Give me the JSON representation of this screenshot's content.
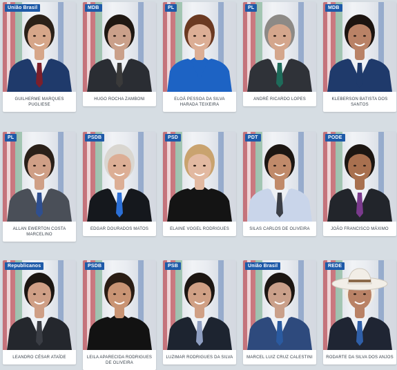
{
  "colors": {
    "badge": "#1e5aa8",
    "background": "#d6dde3",
    "card": "#ffffff",
    "name_text": "#333c46"
  },
  "members": [
    {
      "party": "União Brasil",
      "name": "Guilherme Marques Pugliese",
      "suit": "#1f3a6b",
      "tie": "#7b1f2b",
      "hair": "#2b2118",
      "skin": "#d6a689"
    },
    {
      "party": "MDB",
      "name": "Hugo Rocha Zamboni",
      "suit": "#2a2d33",
      "tie": "#3a3a3a",
      "hair": "#1f1812",
      "skin": "#caa08a"
    },
    {
      "party": "PL",
      "name": "Eloá Pessoa da Silva Harada Teixeira",
      "suit": "#1d63c4",
      "tie": "",
      "hair": "#6b3a22",
      "skin": "#dcae95"
    },
    {
      "party": "PL",
      "name": "André Ricardo Lopes",
      "suit": "#2f3238",
      "tie": "#1e6b5a",
      "hair": "#8d8a86",
      "skin": "#d4a68c"
    },
    {
      "party": "MDB",
      "name": "Kleberson Batista dos Santos",
      "suit": "#1f3a6b",
      "tie": "#1f3a6b",
      "hair": "#1c1410",
      "skin": "#b98266"
    },
    {
      "party": "PL",
      "name": "Allan Ewerton Costa Marcelino",
      "suit": "#4a4f58",
      "tie": "#2f4f8f",
      "hair": "#2a2019",
      "skin": "#cf9f86"
    },
    {
      "party": "PSDB",
      "name": "Edgar Dourados Matos",
      "suit": "#15181d",
      "tie": "#2b6fd6",
      "hair": "#d9d6d0",
      "skin": "#dcae95"
    },
    {
      "party": "PSD",
      "name": "Elaine Vogel Rodrigues",
      "suit": "#141414",
      "tie": "",
      "hair": "#c9a36f",
      "skin": "#e2b9a1"
    },
    {
      "party": "PDT",
      "name": "Silas Carlos de Oliveira",
      "suit": "#c9d5ea",
      "tie": "#3b3f47",
      "hair": "#1c1612",
      "skin": "#c08a6a"
    },
    {
      "party": "PODE",
      "name": "João Francisco Máximo",
      "suit": "#22252b",
      "tie": "#7a3a8c",
      "hair": "#1c1612",
      "skin": "#a8704f"
    },
    {
      "party": "Republicanos",
      "name": "Leandro César Ataíde",
      "suit": "#24272d",
      "tie": "#3a3d44",
      "hair": "#1c1612",
      "skin": "#cf9f86"
    },
    {
      "party": "PSDB",
      "name": "Leila Aparecida Rodrigues de Oliveira",
      "suit": "#121212",
      "tie": "",
      "hair": "#2a1d14",
      "skin": "#c99474"
    },
    {
      "party": "PSB",
      "name": "Luzimar Rodrigues da Silva",
      "suit": "#1d2430",
      "tie": "#8f9fc2",
      "hair": "#1c1612",
      "skin": "#d0a085"
    },
    {
      "party": "União Brasil",
      "name": "Marcel Luiz Cruz Calestini",
      "suit": "#2e4a7d",
      "tie": "#2a5aa0",
      "hair": "#1c1612",
      "skin": "#caa08a"
    },
    {
      "party": "REDE",
      "name": "Rodarte da Silva dos Anjos",
      "suit": "#1f2533",
      "tie": "#2f5fa8",
      "hair": "#f1ece4",
      "skin": "#b98266",
      "hat": true
    }
  ]
}
